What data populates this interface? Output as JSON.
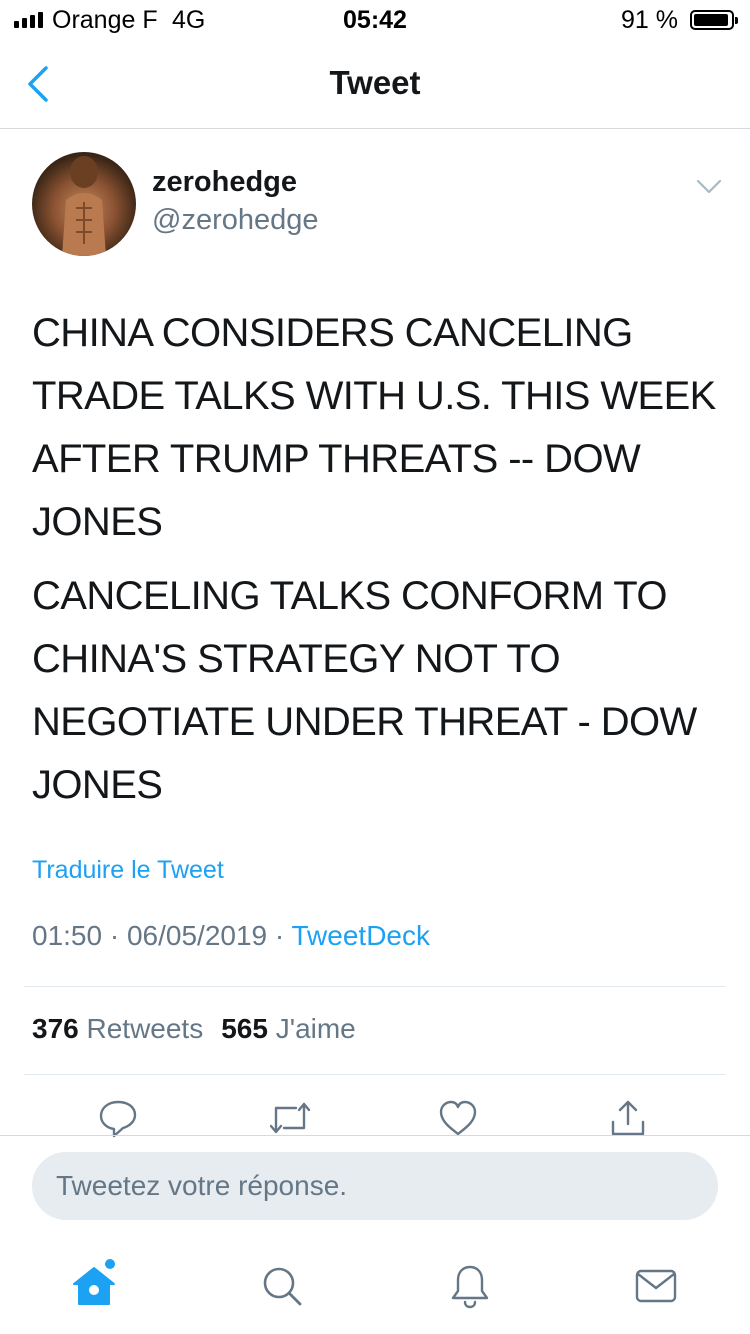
{
  "status_bar": {
    "carrier": "Orange F",
    "network": "4G",
    "time": "05:42",
    "battery": "91 %",
    "battery_level": 0.91
  },
  "nav": {
    "title": "Tweet",
    "back_icon": "chevron-left-icon"
  },
  "tweet": {
    "author_name": "zerohedge",
    "author_handle": "@zerohedge",
    "paragraphs": [
      "CHINA CONSIDERS CANCELING TRADE TALKS WITH U.S. THIS WEEK AFTER TRUMP THREATS -- DOW JONES",
      "CANCELING TALKS CONFORM TO CHINA'S STRATEGY NOT TO NEGOTIATE UNDER THREAT - DOW JONES"
    ],
    "translate_label": "Traduire le Tweet",
    "time": "01:50",
    "date": "06/05/2019",
    "separator": " · ",
    "source": "TweetDeck",
    "retweets_count": "376",
    "retweets_label": " Retweets",
    "likes_count": "565",
    "likes_label": " J'aime"
  },
  "actions": [
    "reply-icon",
    "retweet-icon",
    "like-icon",
    "share-icon"
  ],
  "reply_box": {
    "placeholder": "Tweetez votre réponse."
  },
  "tab_bar": [
    "home-icon",
    "search-icon",
    "notifications-icon",
    "messages-icon"
  ],
  "colors": {
    "accent": "#1da1f2",
    "secondary_text": "#657786",
    "text": "#14171a",
    "reply_bg": "#e6ecf0"
  }
}
